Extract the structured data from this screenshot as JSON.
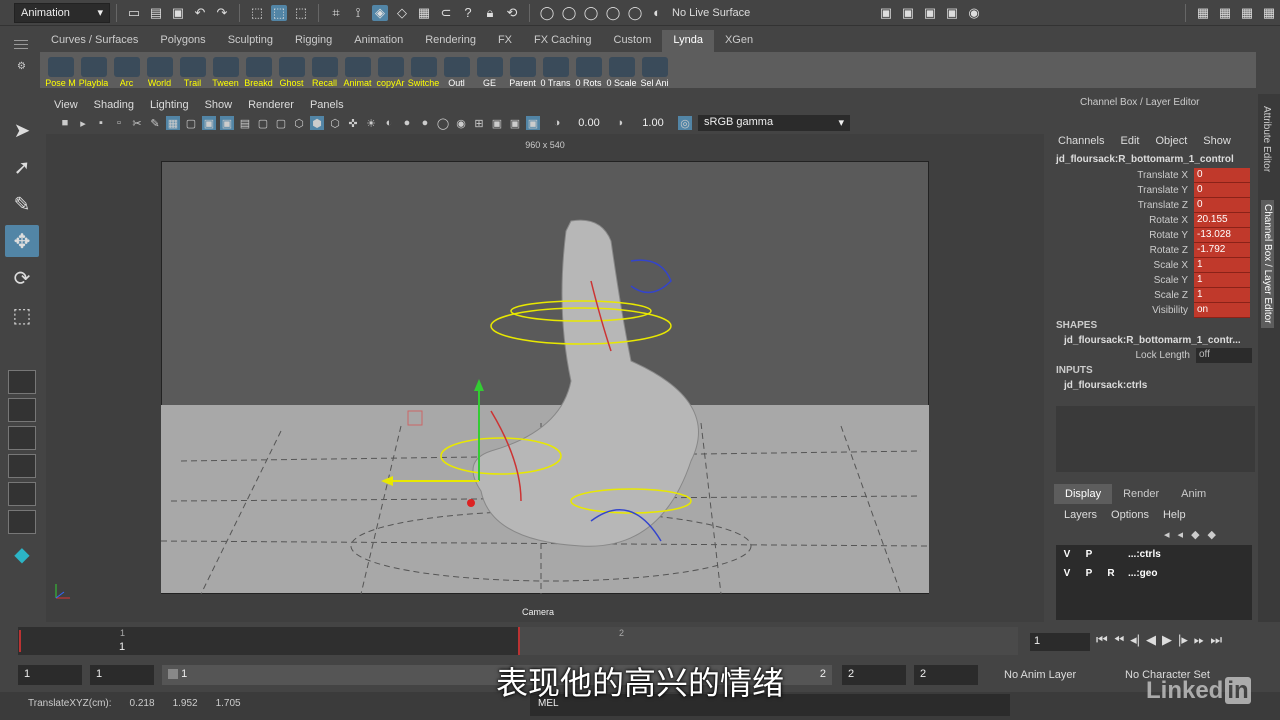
{
  "statusline": {
    "menuset": "Animation",
    "live_surface": "No Live Surface"
  },
  "shelf_tabs": [
    "Curves / Surfaces",
    "Polygons",
    "Sculpting",
    "Rigging",
    "Animation",
    "Rendering",
    "FX",
    "FX Caching",
    "Custom",
    "Lynda",
    "XGen"
  ],
  "shelf_active": "Lynda",
  "shelf_buttons": [
    "Pose M",
    "Playbla",
    "Arc",
    "World",
    "Trail",
    "Tween",
    "Breakd",
    "Ghost",
    "Recall",
    "Animat",
    "copyAr",
    "Switche",
    "Outl",
    "GE",
    "Parent",
    "0 Trans",
    "0 Rots",
    "0 Scale",
    "Sel Ani"
  ],
  "viewport": {
    "menu": [
      "View",
      "Shading",
      "Lighting",
      "Show",
      "Renderer",
      "Panels"
    ],
    "exposure": "0.00",
    "gamma": "1.00",
    "color_space": "sRGB gamma",
    "resolution": "960 x 540",
    "camera": "Camera"
  },
  "channel_box": {
    "title": "Channel Box / Layer Editor",
    "menu": [
      "Channels",
      "Edit",
      "Object",
      "Show"
    ],
    "object": "jd_floursack:R_bottomarm_1_control",
    "channels": [
      {
        "label": "Translate X",
        "value": "0"
      },
      {
        "label": "Translate Y",
        "value": "0"
      },
      {
        "label": "Translate Z",
        "value": "0"
      },
      {
        "label": "Rotate X",
        "value": "20.155"
      },
      {
        "label": "Rotate Y",
        "value": "-13.028"
      },
      {
        "label": "Rotate Z",
        "value": "-1.792"
      },
      {
        "label": "Scale X",
        "value": "1"
      },
      {
        "label": "Scale Y",
        "value": "1"
      },
      {
        "label": "Scale Z",
        "value": "1"
      },
      {
        "label": "Visibility",
        "value": "on"
      }
    ],
    "shapes_header": "SHAPES",
    "shape_name": "jd_floursack:R_bottomarm_1_contr...",
    "lock_length_label": "Lock Length",
    "lock_length_value": "off",
    "inputs_header": "INPUTS",
    "input_name": "jd_floursack:ctrls"
  },
  "layer_editor": {
    "tabs": [
      "Display",
      "Render",
      "Anim"
    ],
    "menu": [
      "Layers",
      "Options",
      "Help"
    ],
    "layers": [
      {
        "v": "V",
        "p": "P",
        "r": "",
        "name": "...:ctrls"
      },
      {
        "v": "V",
        "p": "P",
        "r": "R",
        "name": "...:geo"
      }
    ]
  },
  "side_tabs": [
    "Attribute Editor",
    "Channel Box / Layer Editor"
  ],
  "timeline": {
    "tick1": "1",
    "tick2": "2",
    "current_frame": "1",
    "start_marker": "1"
  },
  "range": {
    "start": "1",
    "inner_start": "1",
    "inner_start2": "1",
    "inner_end": "2",
    "end": "2",
    "end2": "2",
    "anim_layer": "No Anim Layer",
    "char_set": "No Character Set"
  },
  "command": {
    "help_label": "TranslateXYZ(cm):",
    "x": "0.218",
    "y": "1.952",
    "z": "1.705",
    "mel": "MEL"
  },
  "subtitle": "表现他的高兴的情绪",
  "watermark": "Linked",
  "watermark_in": "in"
}
